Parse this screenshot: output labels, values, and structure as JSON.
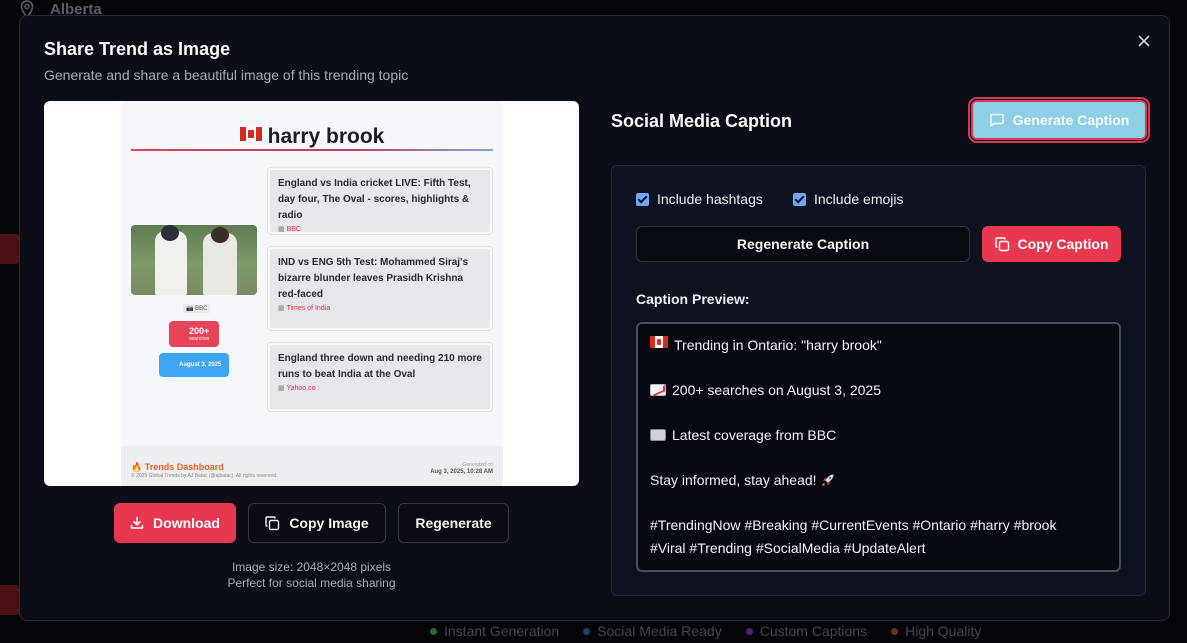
{
  "background": {
    "location": "Alberta",
    "features": [
      {
        "label": "Instant Generation",
        "color": "#22c55e"
      },
      {
        "label": "Social Media Ready",
        "color": "#3b82f6"
      },
      {
        "label": "Custom Captions",
        "color": "#a855f7"
      },
      {
        "label": "High Quality",
        "color": "#f97316"
      }
    ]
  },
  "modal": {
    "title": "Share Trend as Image",
    "subtitle": "Generate and share a beautiful image of this trending topic"
  },
  "preview": {
    "topic": "harry brook",
    "photo_source": "BBC",
    "searches": "200+",
    "searches_sub": "searches",
    "date": "August 3, 2025",
    "news": [
      {
        "title": "England vs India cricket LIVE: Fifth Test, day four, The Oval - scores, highlights & radio",
        "source": "BBC"
      },
      {
        "title": "IND vs ENG 5th Test: Mohammed Siraj's bizarre blunder leaves Prasidh Krishna red-faced",
        "source": "Times of India"
      },
      {
        "title": "England three down and needing 210 more runs to beat India at the Oval",
        "source": "Yahoo.co"
      }
    ],
    "footer_brand": "🔥 Trends Dashboard",
    "footer_copy": "© 2025 Global Trends by AJ Batac (@ajbatac). All rights reserved.",
    "footer_generated": "Generated on",
    "footer_date": "Aug 3, 2025, 10:28 AM"
  },
  "actions": {
    "download": "Download",
    "copy_image": "Copy Image",
    "regenerate": "Regenerate"
  },
  "image_info": {
    "size": "Image size: 2048×2048 pixels",
    "note": "Perfect for social media sharing"
  },
  "caption": {
    "heading": "Social Media Caption",
    "generate_btn": "Generate Caption",
    "include_hashtags": "Include hashtags",
    "include_emojis": "Include emojis",
    "regenerate_btn": "Regenerate Caption",
    "copy_btn": "Copy Caption",
    "preview_label": "Caption Preview:",
    "line1": "Trending in Ontario: \"harry brook\"",
    "line2": "200+ searches on August 3, 2025",
    "line3": "Latest coverage from BBC",
    "line4": "Stay informed, stay ahead!",
    "line5": "#TrendingNow #Breaking #CurrentEvents #Ontario #harry #brook",
    "line6": "#Viral #Trending #SocialMedia #UpdateAlert"
  },
  "colors": {
    "accent_red": "#e8384f",
    "accent_blue": "#8ecfe6",
    "modal_bg": "#0b0d17"
  }
}
